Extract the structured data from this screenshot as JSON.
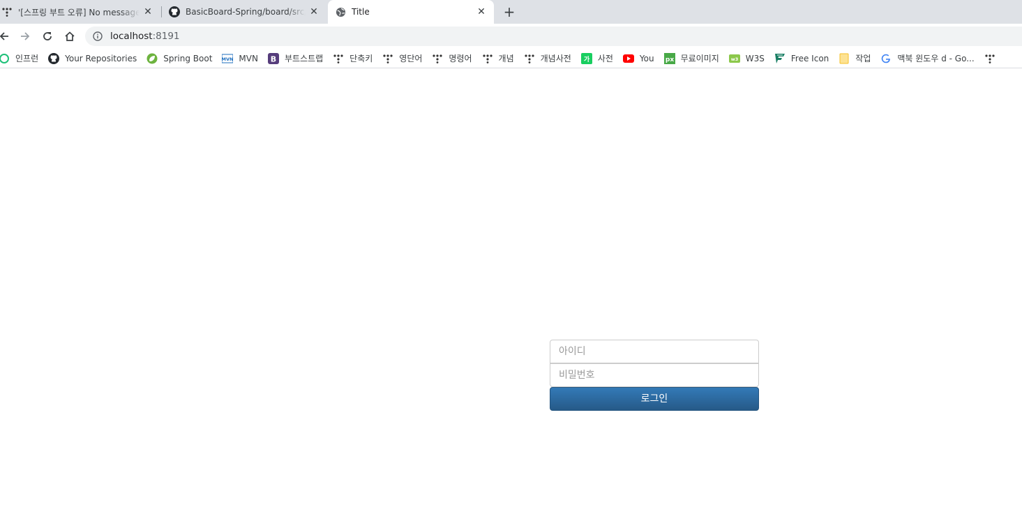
{
  "tabs": [
    {
      "title": "'[스프링 부트 오류] No message",
      "icon": "dots-icon",
      "active": false
    },
    {
      "title": "BasicBoard-Spring/board/src/ma",
      "icon": "github-icon",
      "active": false
    },
    {
      "title": "Title",
      "icon": "globe-icon",
      "active": true
    }
  ],
  "toolbar": {
    "url_host": "localhost",
    "url_port": ":8191"
  },
  "bookmarks": [
    {
      "label": "인프런",
      "icon": "inflearn-icon",
      "color": "#1dc078"
    },
    {
      "label": "Your Repositories",
      "icon": "github-icon",
      "color": "#24292e"
    },
    {
      "label": "Spring Boot",
      "icon": "spring-icon",
      "color": "#6db33f"
    },
    {
      "label": "MVN",
      "icon": "mvn-icon",
      "color": "#1f6fbf"
    },
    {
      "label": "부트스트랩",
      "icon": "bootstrap-icon",
      "color": "#563d7c"
    },
    {
      "label": "단축키",
      "icon": "dots-icon",
      "color": "#333333"
    },
    {
      "label": "영단어",
      "icon": "dots-icon",
      "color": "#333333"
    },
    {
      "label": "명령어",
      "icon": "dots-icon",
      "color": "#333333"
    },
    {
      "label": "개념",
      "icon": "dots-icon",
      "color": "#333333"
    },
    {
      "label": "개념사전",
      "icon": "dots-icon",
      "color": "#333333"
    },
    {
      "label": "사전",
      "icon": "naver-dict-icon",
      "color": "#19ce60"
    },
    {
      "label": "You",
      "icon": "youtube-icon",
      "color": "#ff0000"
    },
    {
      "label": "무료이미지",
      "icon": "pixabay-icon",
      "color": "#48a947"
    },
    {
      "label": "W3S",
      "icon": "w3s-icon",
      "color": "#8cc84b"
    },
    {
      "label": "Free Icon",
      "icon": "flaticon-icon",
      "color": "#1a7f64"
    },
    {
      "label": "작업",
      "icon": "folder-icon",
      "color": "#f9dd6e"
    },
    {
      "label": "맥북 윈도우 d - Go...",
      "icon": "google-icon",
      "color": "#4285f4"
    }
  ],
  "login": {
    "id_placeholder": "아이디",
    "pw_placeholder": "비밀번호",
    "button_label": "로그인",
    "button_color": "#337ab7"
  }
}
